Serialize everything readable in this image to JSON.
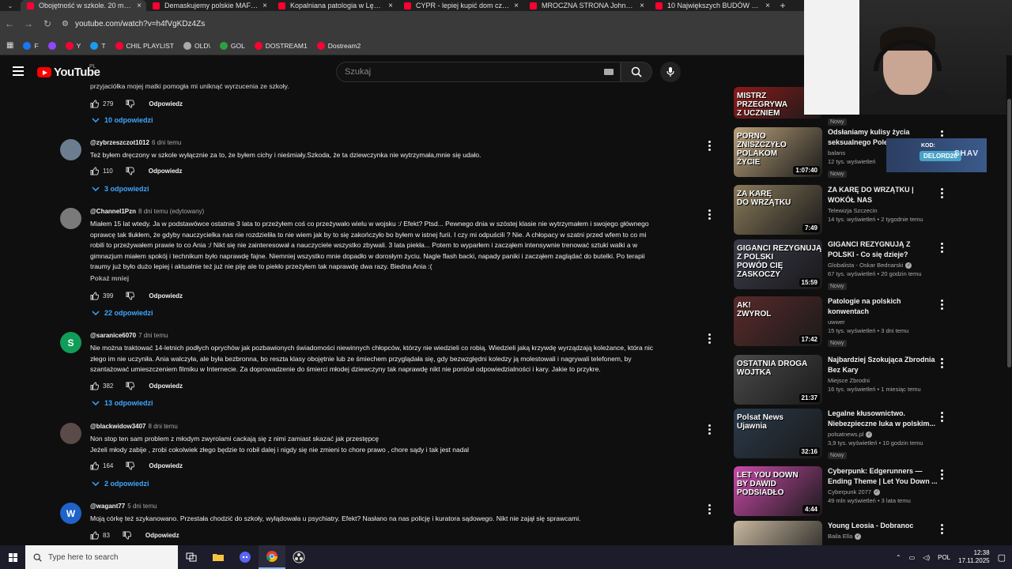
{
  "browser": {
    "tabs": [
      {
        "title": "Obojętność w szkole. 20 minut",
        "active": true
      },
      {
        "title": "Demaskujemy polskie MAFIE ś"
      },
      {
        "title": "Kopalniana patologia w Lędzin"
      },
      {
        "title": "CYPR - lepiej kupić dom czy m"
      },
      {
        "title": "MROCZNA STRONA Johnson &"
      },
      {
        "title": "10 Największych BUDÓW w II R"
      }
    ],
    "url": "youtube.com/watch?v=h4fVgKDz4Zs",
    "bookmarks": [
      {
        "label": "F",
        "color": "#1877f2"
      },
      {
        "label": "",
        "color": "#9146ff"
      },
      {
        "label": "Y",
        "color": "#ff0033"
      },
      {
        "label": "T",
        "color": "#1d9bf0"
      },
      {
        "label": "CHIL PLAYLIST",
        "color": "#ff0033"
      },
      {
        "label": "OLD\\",
        "color": "#aaaaaa"
      },
      {
        "label": "GOL",
        "color": "#2ea043"
      },
      {
        "label": "DOSTREAM1",
        "color": "#ff0033"
      },
      {
        "label": "Dostream2",
        "color": "#ff0033"
      }
    ]
  },
  "masthead": {
    "logo_text": "YouTube",
    "region": "PL",
    "search_placeholder": "Szukaj"
  },
  "comments_top": {
    "cut_text": "przyjaciółka mojej matki pomogła mi uniknąć wyrzucenia ze szkoły.",
    "likes": "279",
    "reply_label": "Odpowiedz",
    "replies_label": "10 odpowiedzi"
  },
  "comments": [
    {
      "author": "@zybrzeszczot1012",
      "time": "6 dni temu",
      "text": "Też byłem dręczony w szkole wyłącznie za to, że byłem cichy i nieśmiały.Szkoda, że ta dziewczynka nie wytrzymała,mnie się udało.",
      "likes": "110",
      "reply_label": "Odpowiedz",
      "replies_label": "3 odpowiedzi",
      "avatar_color": "#6b7d8f",
      "avatar_letter": ""
    },
    {
      "author": "@Channel1Pzn",
      "time": "8 dni temu (edytowany)",
      "text": "Miałem 15 lat wtedy. Ja w podstawówce ostatnie 3 lata to przeżyłem coś co przeżywało wielu w wojsku :/ Efekt? Ptsd... Pewnego dnia w szóstej klasie nie wytrzymałem i swojego głównego\noprawcę tak tłukłem, że gdyby nauczycielka nas nie rozdzieliła to nie wiem jak by to się zakończyło bo byłem w istnej furii. I czy mi odpuścili ? Nie. A chłopacy w szatni przed wfem to co mi\nrobili to przeżywałem prawie to co Ania :/  Nikt się nie zainteresował a nauczyciele wszystko zbywali. 3 lata piekła... Potem to wyparłem i zacząłem intensywnie trenować sztuki walki a w\ngimnazjum miałem spokój i technikum było naprawdę fajne. Niemniej wszystko mnie dopadło w dorosłym życiu. Nagle flash backi, napady paniki i zacząłem zaglądać do butelki. Po terapii\ntraumy już było dużo lepiej i aktualnie też już nie piję ale to piekło przeżyłem tak naprawdę dwa razy. Biedna Ania :(",
      "show_more": "Pokaż mniej",
      "likes": "399",
      "reply_label": "Odpowiedz",
      "replies_label": "22 odpowiedzi",
      "avatar_color": "#7a7a7a",
      "avatar_letter": ""
    },
    {
      "author": "@saranice6070",
      "time": "7 dni temu",
      "text": "Nie można traktować 14-letnich podłych oprychów jak pozbawionych świadomości niewinnych chłopców, którzy nie wiedzieli co robią. Wiedzieli jaką krzywdę wyrządzają koleżance, która nic\nzłego im nie uczyniła. Ania walczyła, ale była bezbronna, bo reszta klasy obojętnie lub ze śmiechem przyglądała się, gdy bezwzględni koledzy ją molestowali i nagrywali telefonem, by\nszantażować umieszczeniem filmiku w Internecie. Za doprowadzenie do śmierci młodej dziewczyny tak naprawdę nikt nie poniósł odpowiedzialności i kary. Jakie to przykre.",
      "likes": "382",
      "reply_label": "Odpowiedz",
      "replies_label": "13 odpowiedzi",
      "avatar_color": "#0f9d58",
      "avatar_letter": "S"
    },
    {
      "author": "@blackwidow3407",
      "time": "8 dni temu",
      "text": "Non stop ten sam problem z młodym zwyrolami cackają się z nimi zamiast skazać jak przestępcę\nJeżeli młody zabije , zrobi cokolwiek złego będzie to robił dalej i nigdy się nie zmieni to chore prawo , chore sądy i tak jest nadal",
      "likes": "164",
      "reply_label": "Odpowiedz",
      "replies_label": "2 odpowiedzi",
      "avatar_color": "#5a4a48",
      "avatar_letter": ""
    },
    {
      "author": "@wagant77",
      "time": "5 dni temu",
      "text": "Moją córkę też szykanowano. Przestała chodzić do szkoły, wylądowała u psychiatry. Efekt? Nasłano na nas policję i kuratora sądowego. Nikt nie zajął się sprawcami.",
      "likes": "83",
      "reply_label": "Odpowiedz",
      "avatar_color": "#1e63c8",
      "avatar_letter": "W"
    }
  ],
  "sidebar": [
    {
      "thumb_label": "MISTRZ\nPRZEGRYWA\nZ UCZNIEM",
      "thumb_color": "#8c1a1a",
      "title": "",
      "channel": "",
      "meta": "",
      "badge": "Nowy",
      "duration": ""
    },
    {
      "thumb_label": "PORNO\nZNISZCZYŁO\nPOLAKOM\nŻYCIE",
      "thumb_color": "#b8a07a",
      "title": "Odsłaniamy kulisy życia seksualnego Pole",
      "channel": "balans",
      "meta": "12 tys. wyświetleń",
      "badge": "Nowy",
      "duration": "1:07:40"
    },
    {
      "thumb_label": "ZA KARĘ\nDO WRZĄTKU",
      "thumb_color": "#8a7a5a",
      "title": "ZA KARĘ DO WRZĄTKU | WOKÓŁ NAS",
      "channel": "Telewizja Szczecin",
      "meta": "14 tys. wyświetleń • 2 tygodnie temu",
      "badge": "",
      "duration": "7:49"
    },
    {
      "thumb_label": "GIGANCI REZYGNUJĄ Z POLSKI\nPOWÓD CIĘ ZASKOCZY",
      "thumb_color": "#3a3a4a",
      "title": "GIGANCI REZYGNUJĄ Z POLSKI - Co się dzieje?",
      "channel": "Globalista - Oskar Bednarski",
      "verified": true,
      "meta": "67 tys. wyświetleń • 20 godzin temu",
      "badge": "Nowy",
      "duration": "15:59"
    },
    {
      "thumb_label": "AK!\nZWYROL",
      "thumb_color": "#5a2a2a",
      "title": "Patologie na polskich konwentach",
      "channel": "uwwer",
      "meta": "15 tys. wyświetleń • 3 dni temu",
      "badge": "Nowy",
      "duration": "17:42"
    },
    {
      "thumb_label": "OSTATNIA DROGA\nWOJTKA",
      "thumb_color": "#4a4a4a",
      "title": "Najbardziej Szokująca Zbrodnia Bez Kary",
      "channel": "Miejsce Zbrodni",
      "meta": "16 tys. wyświetleń • 1 miesiąc temu",
      "badge": "",
      "duration": "21:37"
    },
    {
      "thumb_label": "Polsat News\nUjawnia",
      "thumb_color": "#2a3a4a",
      "title": "Legalne kłusownictwo. Niebezpieczne luka w polskim...",
      "channel": "polsatnews.pl",
      "verified": true,
      "meta": "3,9 tys. wyświetleń • 10 godzin temu",
      "badge": "Nowy",
      "duration": "32:16"
    },
    {
      "thumb_label": "LET YOU DOWN\nBY DAWID PODSIADŁO",
      "thumb_color": "#c84aa8",
      "title": "Cyberpunk: Edgerunners — Ending Theme | Let You Down ...",
      "channel": "Cyberpunk 2077",
      "verified": true,
      "meta": "49 mln wyświetleń • 3 lata temu",
      "badge": "",
      "duration": "4:44"
    },
    {
      "thumb_label": "",
      "thumb_color": "#c8b8a0",
      "title": "Young Leosia - Dobranoc",
      "channel": "Baila Ella",
      "verified": true,
      "meta": "",
      "badge": "",
      "duration": ""
    }
  ],
  "overlay": {
    "kod_label": "KOD:",
    "code": "DELORD20",
    "brand": "SHAV"
  },
  "taskbar": {
    "search_placeholder": "Type here to search",
    "lang": "POL",
    "time": "12:38",
    "date": "17.11.2025"
  }
}
